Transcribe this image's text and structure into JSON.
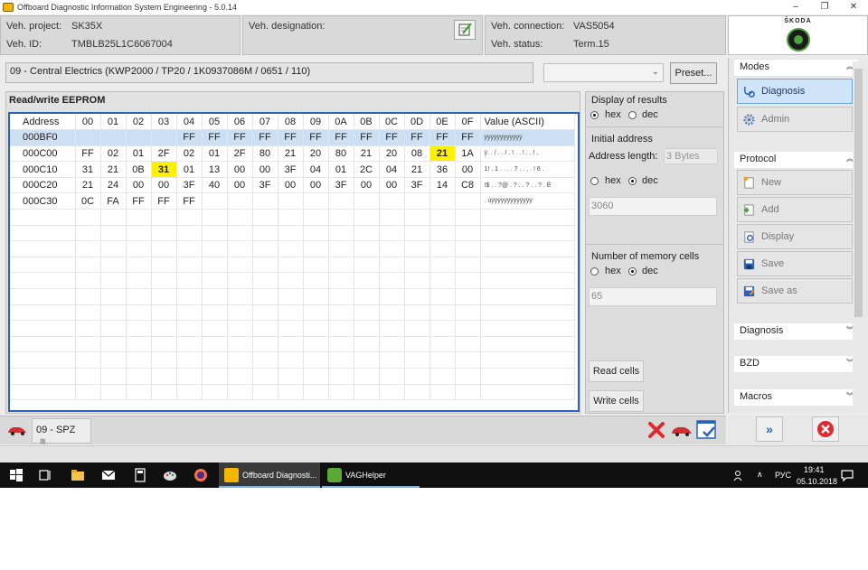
{
  "window": {
    "title": "Offboard Diagnostic Information System Engineering - 5.0.14",
    "controls": [
      "–",
      "❐",
      "✕"
    ]
  },
  "header": {
    "project_label": "Veh. project:",
    "project_value": "SK35X",
    "id_label": "Veh. ID:",
    "id_value": "TMBLB25L1C6067004",
    "designation_label": "Veh. designation:",
    "connection_label": "Veh. connection:",
    "connection_value": "VAS5054",
    "status_label": "Veh. status:",
    "status_value": "Term.15",
    "brand": "ŠKODA"
  },
  "ecu": {
    "label": "09 - Central Electrics  (KWP2000 / TP20 / 1K0937086M  / 0651 / 110)",
    "select_value": "",
    "preset_label": "Preset..."
  },
  "eeprom": {
    "title": "Read/write EEPROM",
    "columns": [
      "Address",
      "00",
      "01",
      "02",
      "03",
      "04",
      "05",
      "06",
      "07",
      "08",
      "09",
      "0A",
      "0B",
      "0C",
      "0D",
      "0E",
      "0F",
      "Value (ASCII)"
    ],
    "rows": [
      {
        "address": "000BF0",
        "cells": [
          "",
          "",
          "",
          "",
          "FF",
          "FF",
          "FF",
          "FF",
          "FF",
          "FF",
          "FF",
          "FF",
          "FF",
          "FF",
          "FF",
          "FF"
        ],
        "ascii": "ÿÿÿÿÿÿÿÿÿÿÿÿ",
        "selected": true
      },
      {
        "address": "000C00",
        "cells": [
          "FF",
          "02",
          "01",
          "2F",
          "02",
          "01",
          "2F",
          "80",
          "21",
          "20",
          "80",
          "21",
          "20",
          "08",
          "21",
          "1A"
        ],
        "ascii": "ÿ. . / . . / . ! . . ! . . ! .",
        "selected": false
      },
      {
        "address": "000C10",
        "cells": [
          "31",
          "21",
          "0B",
          "31",
          "01",
          "13",
          "00",
          "00",
          "3F",
          "04",
          "01",
          "2C",
          "04",
          "21",
          "36",
          "00"
        ],
        "ascii": "1! . 1 . . . . ? . . , . ! 6 .",
        "selected": false
      },
      {
        "address": "000C20",
        "cells": [
          "21",
          "24",
          "00",
          "00",
          "3F",
          "40",
          "00",
          "3F",
          "00",
          "00",
          "3F",
          "00",
          "00",
          "3F",
          "14",
          "C8"
        ],
        "ascii": "!$ . . ?@ . ? . . ? . . ? . È",
        "selected": false
      },
      {
        "address": "000C30",
        "cells": [
          "0C",
          "FA",
          "FF",
          "FF",
          "FF",
          "",
          "",
          "",
          "",
          "",
          "",
          "",
          "",
          "",
          "",
          ""
        ],
        "ascii": ". úÿÿÿÿÿÿÿÿÿÿÿÿÿ",
        "selected": false
      }
    ],
    "highlight_color": "#ffef00",
    "selection_color": "#cde0f3"
  },
  "options": {
    "display_title": "Display of results",
    "hex_label": "hex",
    "dec_label": "dec",
    "initial_title": "Initial address",
    "address_length_label": "Address length:",
    "address_length_value": "3 Bytes",
    "initial_value": "3060",
    "cells_title": "Number of memory cells",
    "cells_value": "65",
    "read_label": "Read cells",
    "write_label": "Write cells"
  },
  "sidebar": {
    "modes_title": "Modes",
    "diagnosis_label": "Diagnosis",
    "admin_label": "Admin",
    "protocol_title": "Protocol",
    "new_label": "New",
    "add_label": "Add",
    "display_label": "Display",
    "save_label": "Save",
    "saveas_label": "Save as",
    "diagnosis_section": "Diagnosis",
    "bzd_section": "BZD",
    "macros_section": "Macros"
  },
  "tabs": {
    "spz_label": "09 - SPZ",
    "spz_close": "⊠"
  },
  "taskbar": {
    "odis_label": "Offboard Diagnosti...",
    "vag_label": "VAGHelper",
    "lang": "РУС",
    "time": "19:41",
    "date": "05.10.2018"
  },
  "colors": {
    "accent": "#2a62b8",
    "skoda_green": "#4ca33b",
    "close_red": "#e0282e"
  }
}
